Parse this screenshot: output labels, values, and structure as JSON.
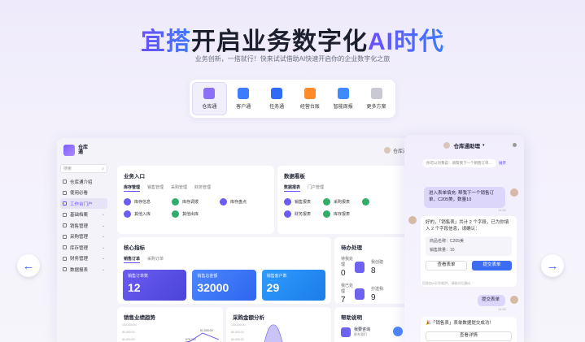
{
  "hero": {
    "title_highlight": "宜搭",
    "title_main": "开启业务数字化",
    "title_ai": "AI时代",
    "subtitle": "业务创新，一搭就行！快来试试借助AI快速开启你的企业数字化之旅"
  },
  "products": [
    {
      "label": "仓库通",
      "color": "#8b6ff5"
    },
    {
      "label": "客户通",
      "color": "#3d7bff"
    },
    {
      "label": "任务通",
      "color": "#2f6cf6"
    },
    {
      "label": "经营台账",
      "color": "#ff8a2a"
    },
    {
      "label": "智能周报",
      "color": "#3d8bff"
    },
    {
      "label": "更多方案",
      "color": "#c8c9d2"
    }
  ],
  "app": {
    "logo": "仓库通",
    "assistant_link": "仓库通助理",
    "search_placeholder": "搜索",
    "sidebar": [
      {
        "label": "仓库通介绍"
      },
      {
        "label": "使用必看"
      },
      {
        "label": "工作台门户"
      },
      {
        "label": "基础档案"
      },
      {
        "label": "销售管理"
      },
      {
        "label": "采购管理"
      },
      {
        "label": "库存管理"
      },
      {
        "label": "财务管理"
      },
      {
        "label": "数据报表"
      }
    ],
    "business_entry": {
      "title": "业务入口",
      "tabs": [
        "库存管理",
        "销售管理",
        "采购管理",
        "财务管理"
      ],
      "items": [
        {
          "label": "库存信息",
          "color": "#6d5cf0"
        },
        {
          "label": "库存调拨",
          "color": "#2fae6b"
        },
        {
          "label": "库存盘点",
          "color": "#6d5cf0"
        },
        {
          "label": "其他入库",
          "color": "#6d5cf0"
        },
        {
          "label": "其他出库",
          "color": "#2fae6b"
        }
      ]
    },
    "data_board": {
      "title": "数据看板",
      "tabs": [
        "数据报表",
        "门户管理"
      ],
      "items": [
        {
          "label": "销售报表",
          "color": "#6d5cf0"
        },
        {
          "label": "采购报表",
          "color": "#2fae6b"
        },
        {
          "label": "财务报表",
          "color": "#6d5cf0"
        },
        {
          "label": "库存报表",
          "color": "#2fae6b"
        }
      ]
    },
    "core_metrics": {
      "title": "核心指标",
      "tabs": [
        "销售订单",
        "采购订单"
      ],
      "metrics": [
        {
          "label": "销售订单数",
          "value": "12",
          "color": "#5b4fe8"
        },
        {
          "label": "销售总金额",
          "value": "32000",
          "color": "#3d7bff"
        },
        {
          "label": "销售客户数",
          "value": "29",
          "color": "#1e8bf2"
        }
      ]
    },
    "todo": {
      "title": "待办处理",
      "items": [
        {
          "label": "待我处理",
          "value": "0"
        },
        {
          "label": "我创建",
          "value": "8"
        },
        {
          "label": "我已处理",
          "value": "7"
        },
        {
          "label": "抄送我",
          "value": "9"
        }
      ]
    },
    "sales_trend": {
      "title": "销售业绩趋势",
      "ticks": [
        "100,000.00",
        "80,000.00",
        "60,000.00"
      ],
      "peak_label": "¥1,000.00",
      "point_label": "¥75,000"
    },
    "purchase_analysis": {
      "title": "采购金额分析",
      "ticks": [
        "100,000.00",
        "80,000.00",
        "60,000.00"
      ]
    },
    "help": {
      "title": "帮助说明",
      "item": "我要咨询",
      "item_sub": "联系我们"
    }
  },
  "chat": {
    "title": "仓库通助理",
    "tag_text": "你可以对我说：请帮我下一个销售订单…",
    "tag_link": "展开",
    "user_msg": "进入表单填充: 帮我下一个销售订单，C205美，数量10",
    "time1": "11:52",
    "bot_msg": "好的，「销售表」共计 2 个字段，已为你填入 2 个字段信息，请确认：",
    "field1": "商品名称：C205美",
    "field2": "销售数量：10",
    "btn_view": "查看表单",
    "btn_submit": "提交表单",
    "disclaimer": "回答由AI识别组件，请核对后确认",
    "user_msg2": "提交表单",
    "time2": "11:52",
    "success_msg": "🎉「销售表」表单数据提交成功！",
    "btn_detail": "查看详情"
  }
}
